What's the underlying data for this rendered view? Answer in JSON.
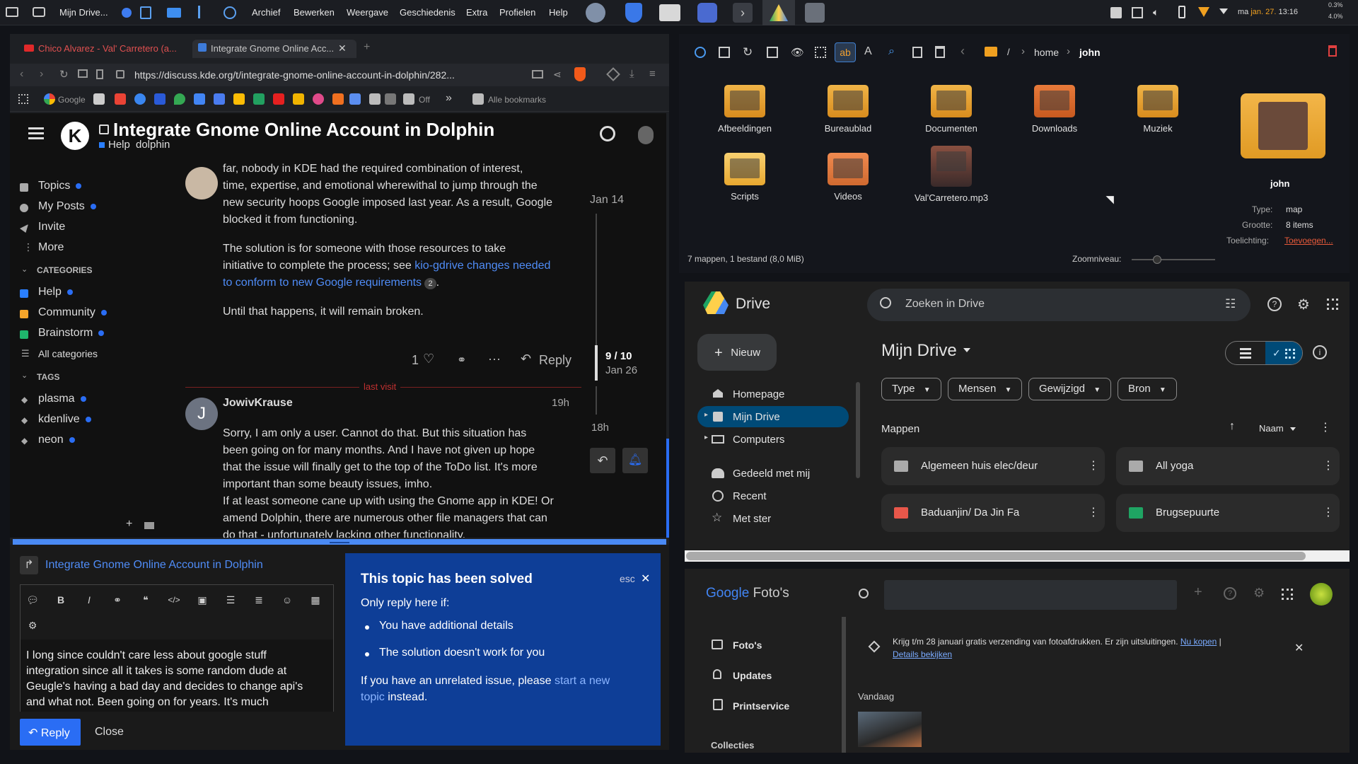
{
  "panel": {
    "app_name": "Mijn Drive...",
    "menus": [
      "Archief",
      "Bewerken",
      "Weergave",
      "Geschiedenis",
      "Extra",
      "Profielen",
      "Help"
    ],
    "date": "jan. 27.",
    "day": "ma",
    "time": "13:16",
    "cpu1": "0.3%",
    "cpu2": "4.0%"
  },
  "browser": {
    "tab1": "Chico Alvarez - Val' Carretero (a...",
    "tab2": "Integrate Gnome Online Acc...",
    "url": "https://discuss.kde.org/t/integrate-gnome-online-account-in-dolphin/282...",
    "bookmarks": {
      "google": "Google",
      "off": "Off",
      "all": "Alle bookmarks"
    }
  },
  "discourse": {
    "title": "Integrate Gnome Online Account in Dolphin",
    "category": "Help",
    "tag": "dolphin",
    "sidebar": {
      "topics": "Topics",
      "myposts": "My Posts",
      "invite": "Invite",
      "more": "More",
      "categories_heading": "CATEGORIES",
      "cat_help": "Help",
      "cat_community": "Community",
      "cat_brainstorm": "Brainstorm",
      "all_categories": "All categories",
      "tags_heading": "TAGS",
      "tag1": "plasma",
      "tag2": "kdenlive",
      "tag3": "neon"
    },
    "post1": {
      "line1": "far, nobody in KDE had the required combination of interest,",
      "line2": "time, expertise, and emotional wherewithal to jump through the",
      "line3": "new security hoops Google imposed last year. As a result, Google",
      "line4": "blocked it from functioning.",
      "para2a": "The solution is for someone with those resources to take",
      "para2b": "initiative to complete the process; see ",
      "link1": "kio-gdrive changes needed",
      "link2": "to conform to new Google requirements",
      "link_count": "2",
      "para3": "Until that happens, it will remain broken.",
      "likes": "1",
      "reply": "Reply"
    },
    "timeline": {
      "date1": "Jan 14",
      "position": "9 / 10",
      "date2": "Jan 26",
      "ago": "18h"
    },
    "last_visit": "last visit",
    "post2": {
      "author": "JowivKrause",
      "avatar_letter": "J",
      "time": "19h",
      "l1": "Sorry, I am only a user. Cannot do that. But this situation has",
      "l2": "been going on for many months. And I have not given up hope",
      "l3": "that the issue will finally get to the top of the ToDo list. It's more",
      "l4": "important than some beauty issues, imho.",
      "l5": "If at least someone cane up with using the Gnome app in KDE! Or",
      "l6": "amend Dolphin, there are numerous other file managers that can",
      "l7": "do that - unfortunately lacking other functionality."
    }
  },
  "composer": {
    "topic": "Integrate Gnome Online Account in Dolphin",
    "text1": "I long since couldn't care less about google stuff",
    "text2": "integration since all it takes is some random dude at",
    "text3": "Geugle's having a bad day and decides to change api's",
    "text4": "and what not. Been going on for years. It's much",
    "reply": "Reply",
    "close": "Close"
  },
  "solved": {
    "title": "This topic has been solved",
    "esc": "esc",
    "only": "Only reply here if:",
    "b1": "You have additional details",
    "b2": "The solution doesn't work for you",
    "p1": "If you have an unrelated issue, please ",
    "link": "start a new",
    "link2": "topic",
    "p2": " instead."
  },
  "dolphin": {
    "path_root": "/",
    "path1": "home",
    "path2": "john",
    "folders": [
      "Afbeeldingen",
      "Bureaublad",
      "Documenten",
      "Downloads",
      "Muziek",
      "Scripts",
      "Videos",
      "Val'Carretero.mp3"
    ],
    "info_name": "john",
    "type_label": "Type:",
    "type_value": "map",
    "size_label": "Grootte:",
    "size_value": "8 items",
    "note_label": "Toelichting:",
    "note_value": "Toevoegen...",
    "status": "7 mappen, 1 bestand (8,0 MiB)",
    "zoom": "Zoomniveau:"
  },
  "drive": {
    "title": "Drive",
    "search": "Zoeken in Drive",
    "new": "Nieuw",
    "nav": [
      "Homepage",
      "Mijn Drive",
      "Computers",
      "Gedeeld met mij",
      "Recent",
      "Met ster"
    ],
    "heading": "Mijn Drive",
    "filters": [
      "Type",
      "Mensen",
      "Gewijzigd",
      "Bron"
    ],
    "folders_heading": "Mappen",
    "sort": "Naam",
    "folders": [
      "Algemeen huis elec/deur",
      "All yoga",
      "Baduanjin/ Da Jin Fa",
      "Brugsepuurte"
    ]
  },
  "photos": {
    "title_google": "Google",
    "title": "Foto's",
    "nav": [
      "Foto's",
      "Updates",
      "Printservice"
    ],
    "collections": "Collecties",
    "banner": "Krijg t/m 28 januari gratis verzending van fotoafdrukken. Er zijn uitsluitingen.",
    "buy": "Nu kopen",
    "details": "Details bekijken",
    "today": "Vandaag"
  },
  "colors": {
    "accent": "#2a6df4",
    "help": "#2a7fff",
    "community": "#f4a52a",
    "brainstorm": "#1fb56c",
    "solved": "#0e3e97",
    "drive_sel": "#004a77"
  }
}
